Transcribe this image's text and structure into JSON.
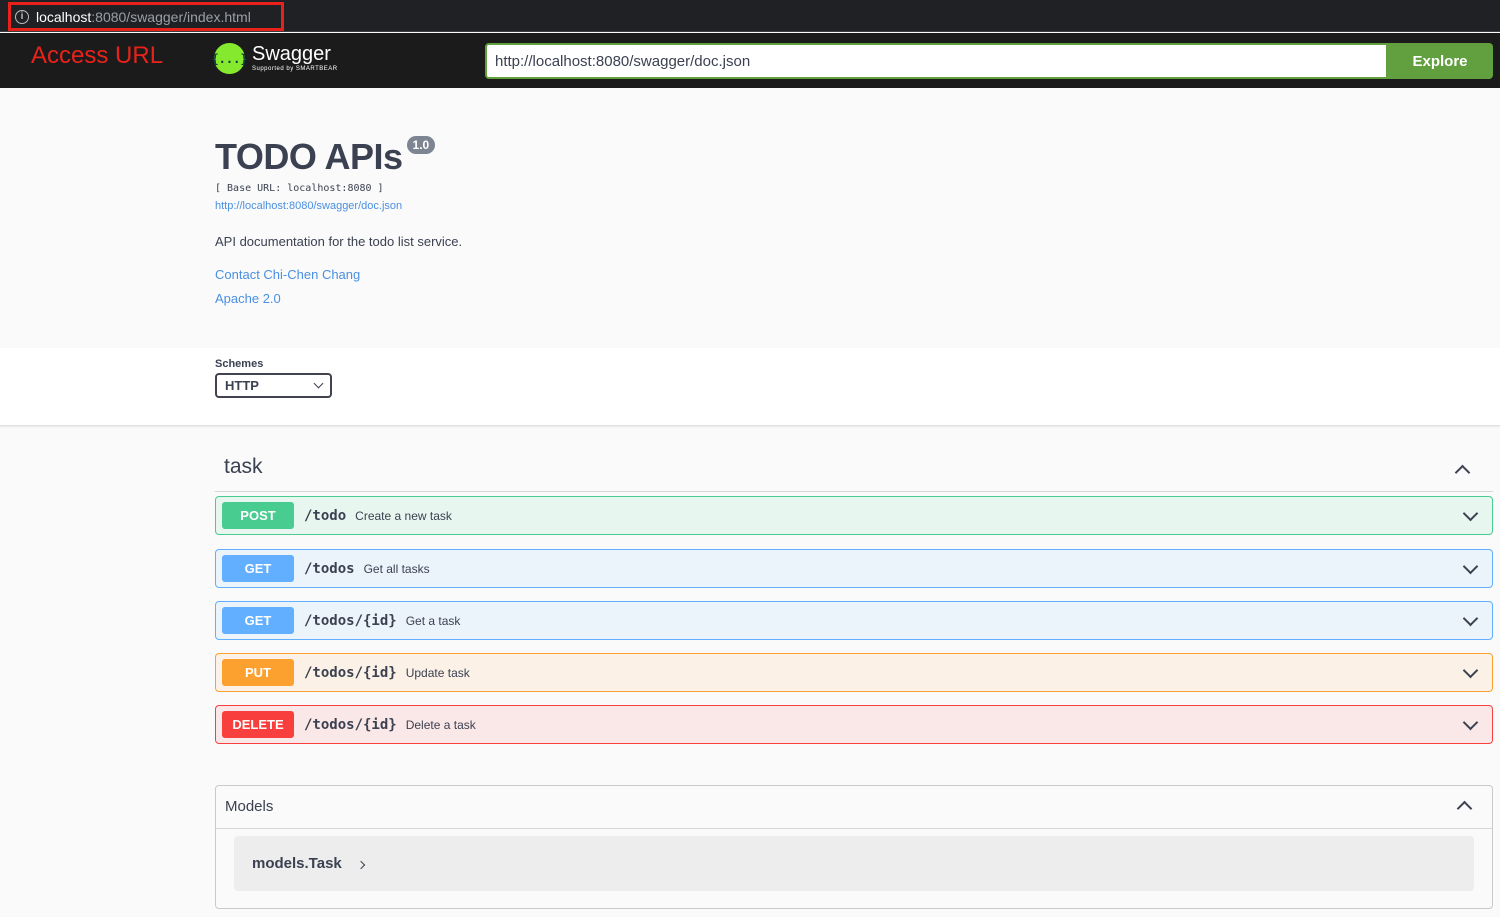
{
  "browser": {
    "url_host": "localhost",
    "url_rest": ":8080/swagger/index.html"
  },
  "annotation": "Access URL",
  "topbar": {
    "logo_name": "Swagger",
    "logo_sub": "Supported by SMARTBEAR",
    "logo_glyph": "{...}",
    "spec_url": "http://localhost:8080/swagger/doc.json",
    "explore_label": "Explore"
  },
  "info": {
    "title": "TODO APIs",
    "version": "1.0",
    "base_url": "[ Base URL: localhost:8080 ]",
    "spec_link": "http://localhost:8080/swagger/doc.json",
    "description": "API documentation for the todo list service.",
    "contact": "Contact Chi-Chen Chang",
    "license": "Apache 2.0"
  },
  "schemes": {
    "label": "Schemes",
    "selected": "HTTP"
  },
  "tag": {
    "name": "task",
    "operations": [
      {
        "method": "POST",
        "path": "/todo",
        "summary": "Create a new task"
      },
      {
        "method": "GET",
        "path": "/todos",
        "summary": "Get all tasks"
      },
      {
        "method": "GET",
        "path": "/todos/{id}",
        "summary": "Get a task"
      },
      {
        "method": "PUT",
        "path": "/todos/{id}",
        "summary": "Update task"
      },
      {
        "method": "DELETE",
        "path": "/todos/{id}",
        "summary": "Delete a task"
      }
    ]
  },
  "models": {
    "title": "Models",
    "items": [
      {
        "name": "models.Task"
      }
    ]
  },
  "colors": {
    "post": "#49cc90",
    "get": "#61affe",
    "put": "#fca130",
    "delete": "#f93e3e",
    "explore": "#62a03f",
    "annotation": "#e8221b"
  }
}
